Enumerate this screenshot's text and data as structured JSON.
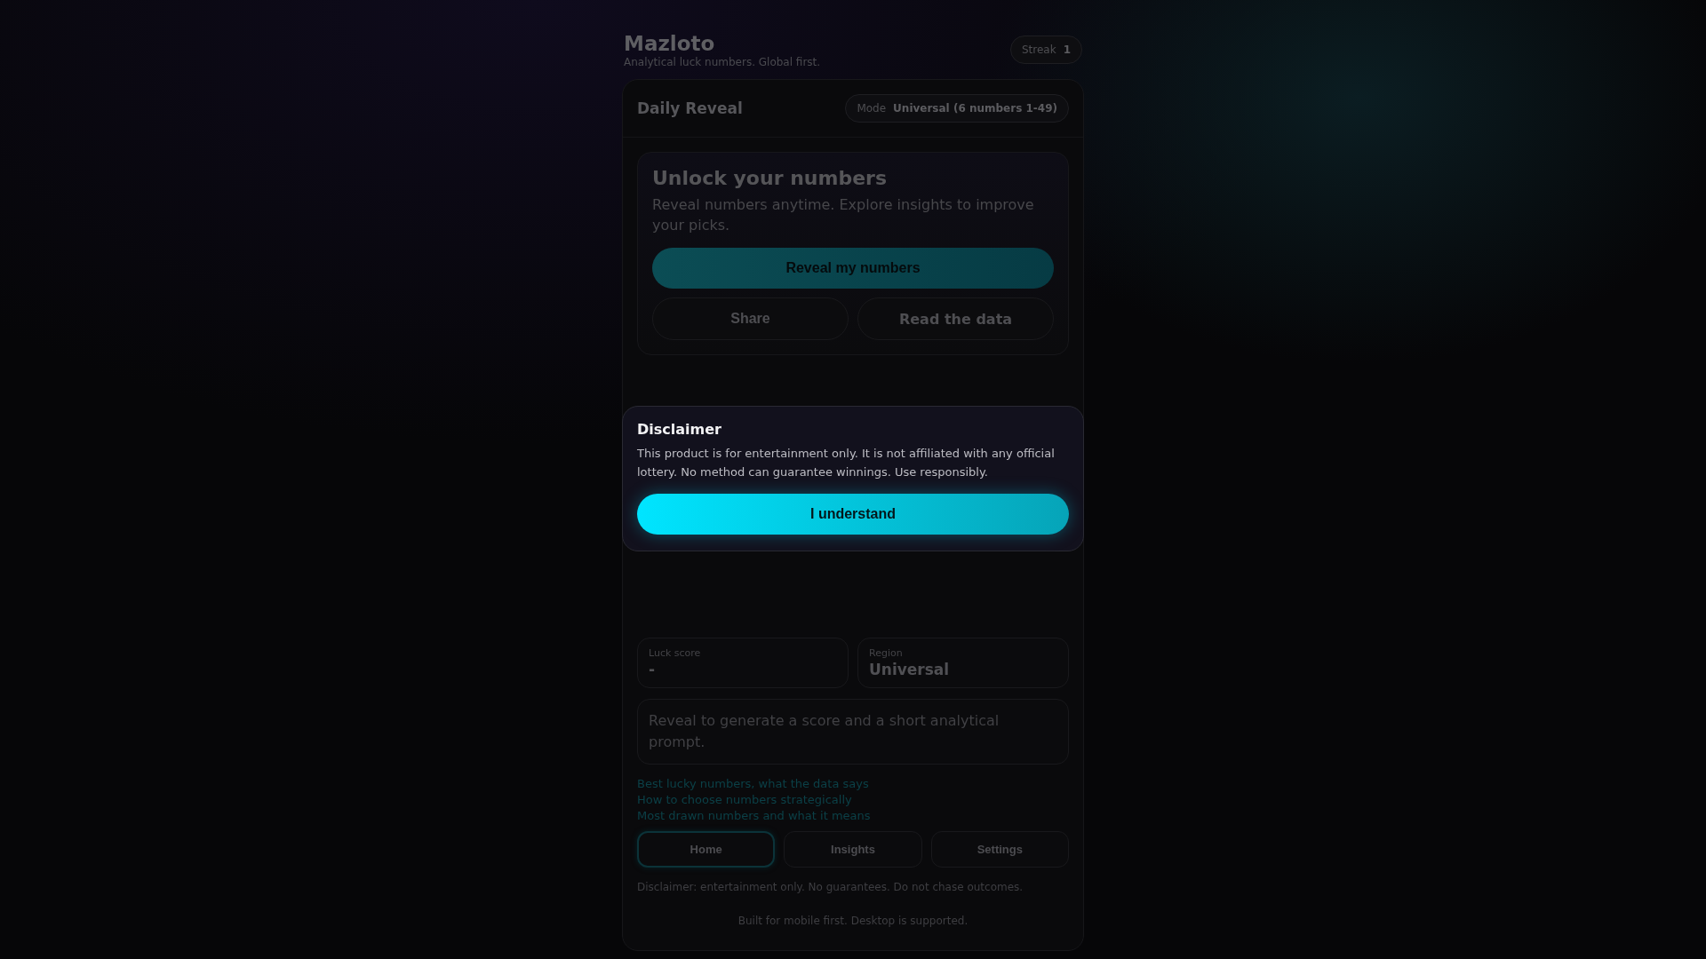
{
  "header": {
    "title": "Mazloto",
    "subtitle": "Analytical luck numbers. Global first.",
    "streak": {
      "label": "Streak",
      "value": "1"
    }
  },
  "card": {
    "title": "Daily Reveal",
    "mode": {
      "label": "Mode",
      "value": "Universal (6 numbers 1-49)"
    },
    "hero": {
      "title": "Unlock your numbers",
      "text": "Reveal numbers anytime. Explore insights to improve your picks.",
      "primary_button": "Reveal my numbers",
      "buttons": [
        "Share",
        "Read the data"
      ]
    },
    "stats": [
      {
        "label": "Luck score",
        "value": "-"
      },
      {
        "label": "Region",
        "value": "Universal"
      }
    ],
    "prompt": "Reveal to generate a score and a short analytical prompt.",
    "links": [
      "Best lucky numbers, what the data says",
      "How to choose numbers strategically",
      "Most drawn numbers and what it means"
    ],
    "nav": [
      {
        "label": "Home",
        "selected": true
      },
      {
        "label": "Insights",
        "selected": false
      },
      {
        "label": "Settings",
        "selected": false
      }
    ],
    "disclaimer": "Disclaimer: entertainment only. No guarantees. Do not chase outcomes.",
    "footer": "Built for mobile first. Desktop is supported."
  },
  "modal": {
    "title": "Disclaimer",
    "text": "This product is for entertainment only. It is not affiliated with any official lottery. No method can guarantee winnings. Use responsibly.",
    "button": "I understand"
  }
}
